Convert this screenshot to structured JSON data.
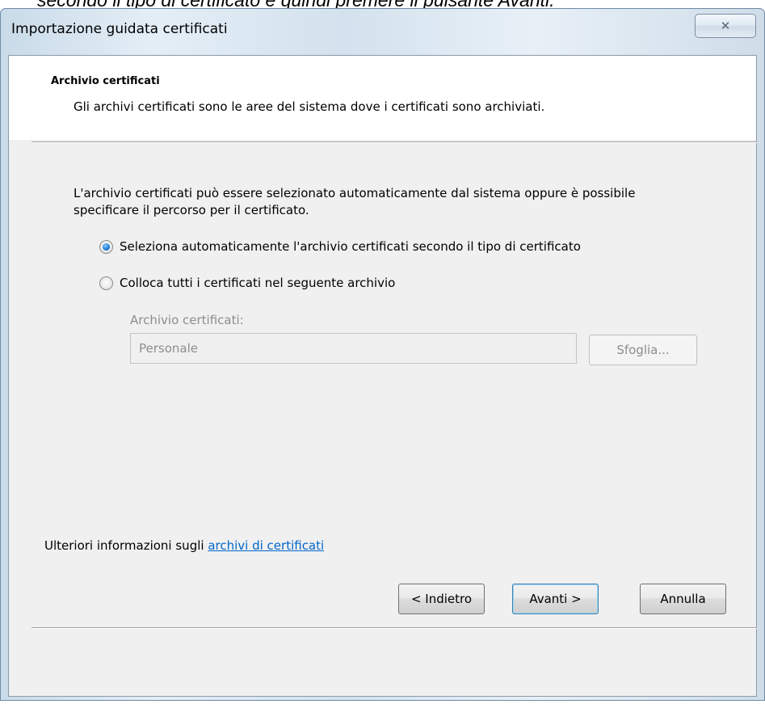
{
  "document": {
    "caption": "secondo il tipo di certificato e quindi premere il pulsante Avanti."
  },
  "window": {
    "title": "Importazione guidata certificati",
    "close_icon": "close-icon"
  },
  "header": {
    "title": "Archivio certificati",
    "description": "Gli archivi certificati sono le aree del sistema dove i certificati sono archiviati."
  },
  "body": {
    "intro": "L'archivio certificati può essere selezionato automaticamente dal sistema oppure è possibile specificare il percorso per il certificato.",
    "options": [
      {
        "label": "Seleziona automaticamente l'archivio certificati secondo il tipo di certificato",
        "selected": true
      },
      {
        "label": "Colloca tutti i certificati nel seguente archivio",
        "selected": false
      }
    ],
    "store_label": "Archivio certificati:",
    "store_value": "Personale",
    "browse_label": "Sfoglia..."
  },
  "footer": {
    "more_info_prefix": "Ulteriori informazioni sugli ",
    "more_info_link": "archivi di certificati",
    "back_label": "< Indietro",
    "next_label": "Avanti >",
    "cancel_label": "Annulla"
  },
  "colors": {
    "link": "#0066cc",
    "accent": "#1f7fd6",
    "disabled_text": "#8d8d8d"
  }
}
